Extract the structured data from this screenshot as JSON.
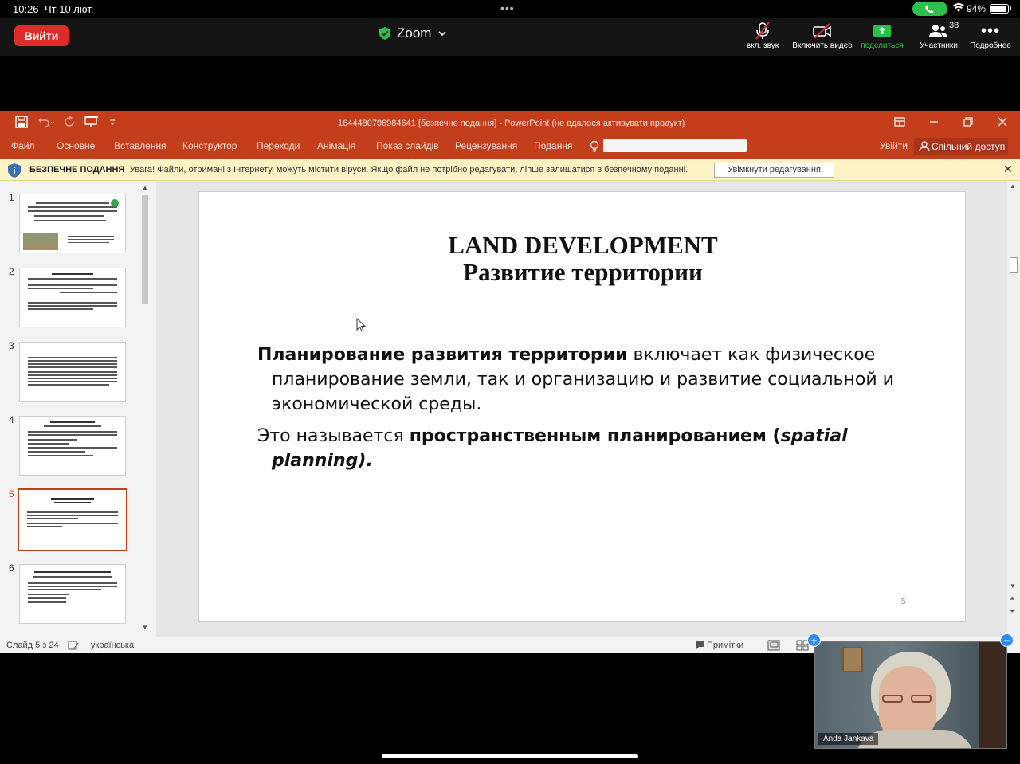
{
  "status_bar": {
    "time": "10:26",
    "date": "Чт 10 лют.",
    "battery_pct": "94%",
    "battery_level": 0.94
  },
  "zoom": {
    "leave_label": "Вийти",
    "title": "Zoom",
    "controls": {
      "audio": "вкл. звук",
      "video": "Включить видео",
      "share": "поделиться",
      "participants": "Участники",
      "participants_count": "38",
      "more": "Подробнее"
    }
  },
  "ppt": {
    "doc_title": "1644480796984641 [безпечне подання] - PowerPoint (не вдалося активувати продукт)",
    "menu": [
      "Файл",
      "Основне",
      "Вставлення",
      "Конструктор",
      "Переходи",
      "Анімація",
      "Показ слайдів",
      "Рецензування",
      "Подання"
    ],
    "sign_in": "Увійти",
    "share": "Спільний доступ",
    "protected": {
      "label": "БЕЗПЕЧНЕ ПОДАННЯ",
      "message": "Увага! Файли, отримані з Інтернету, можуть містити віруси. Якщо файл не потрібно редагувати, ліпше залишатися в безпечному поданні.",
      "button": "Увімкнути редагування"
    },
    "thumbnails": [
      "1",
      "2",
      "3",
      "4",
      "5",
      "6"
    ],
    "selected_slide": 5,
    "slide": {
      "title_line1": "LAND DEVELOPMENT",
      "title_line2": "Развитие территории",
      "p1_bold": "Планирование развития территории",
      "p1_rest": " включает как физическое планирование земли, так и организацию и развитие социальной и экономической среды.",
      "p2_start": "Это называется ",
      "p2_bold": "пространственным планированием",
      "p2_paren": " (",
      "p2_italic": "spatial planning",
      "p2_end": ").",
      "number": "5"
    },
    "status": {
      "slide_counter": "Слайд 5 з 24",
      "language": "українська",
      "notes": "Примітки"
    }
  },
  "video_tile": {
    "name": "Anda Jankava"
  },
  "colors": {
    "ppt_accent": "#c43e1c",
    "zoom_leave": "#e02b2b",
    "zoom_share": "#27c24a"
  }
}
